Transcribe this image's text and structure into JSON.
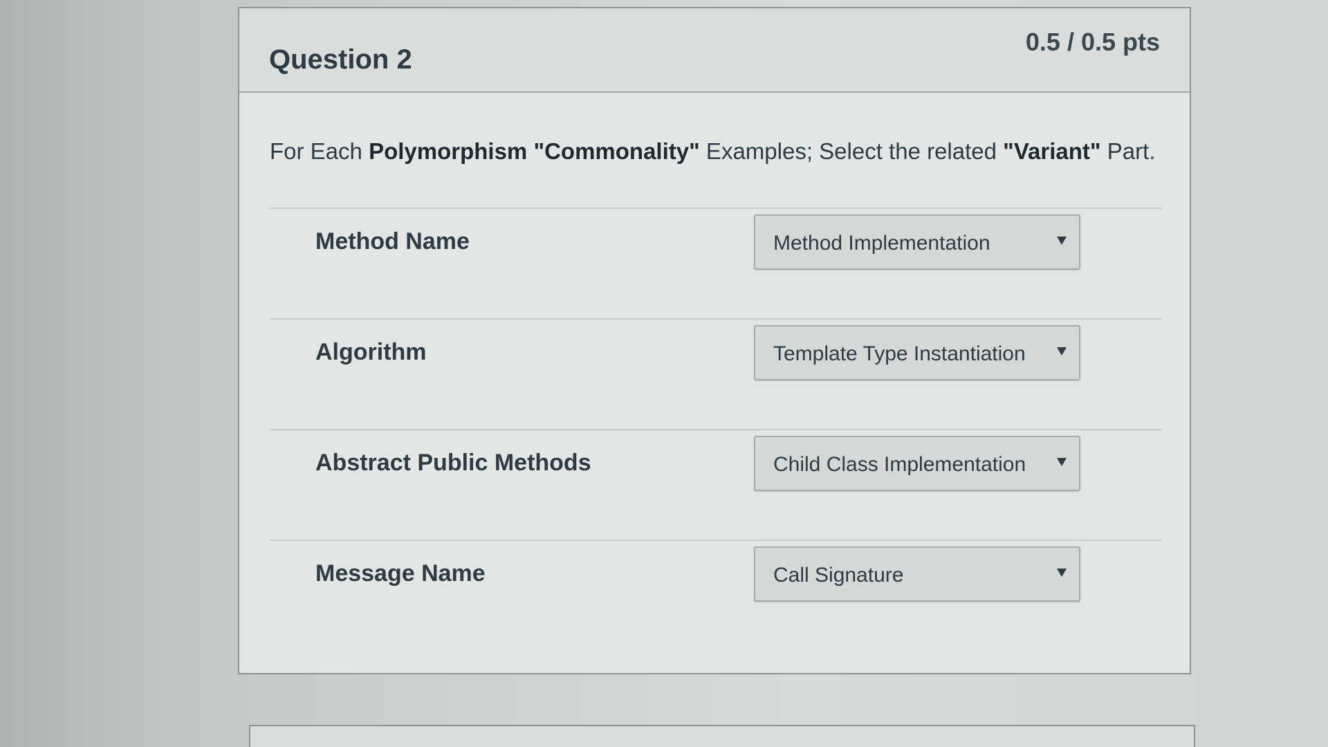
{
  "question": {
    "title": "Question 2",
    "points": "0.5 / 0.5 pts",
    "prompt_parts": [
      {
        "text": "For Each ",
        "bold": false
      },
      {
        "text": "Polymorphism \"Commonality\"",
        "bold": true
      },
      {
        "text": " Examples; Select the related ",
        "bold": false
      },
      {
        "text": "\"Variant\"",
        "bold": true
      },
      {
        "text": " Part.",
        "bold": false
      }
    ],
    "rows": [
      {
        "label": "Method Name",
        "selected": "Method Implementation"
      },
      {
        "label": "Algorithm",
        "selected": "Template Type Instantiation"
      },
      {
        "label": "Abstract Public Methods",
        "selected": "Child Class Implementation"
      },
      {
        "label": "Message Name",
        "selected": "Call Signature"
      }
    ]
  },
  "colors": {
    "text": "#2d3b45",
    "card_bg": "#e2e7e5",
    "header_bg": "#d9dedc",
    "select_bg": "#d4d8d7",
    "border": "#8d9594"
  },
  "icons": {
    "dropdown": "caret-down-icon"
  }
}
